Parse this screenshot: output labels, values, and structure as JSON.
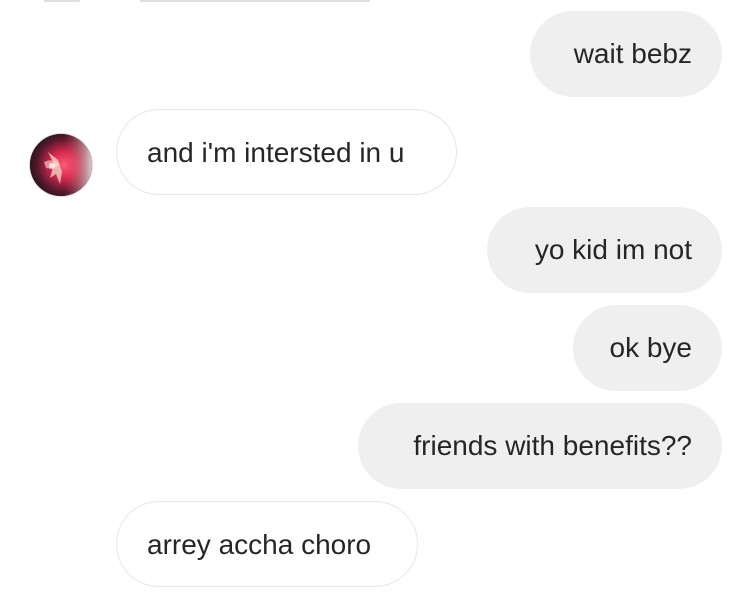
{
  "conversation": {
    "messages": [
      {
        "direction": "sent",
        "text": "wait bebz"
      },
      {
        "direction": "received",
        "text": "and i'm intersted in u",
        "show_avatar": true
      },
      {
        "direction": "sent",
        "text": "yo kid im not"
      },
      {
        "direction": "sent",
        "text": "ok bye"
      },
      {
        "direction": "sent",
        "text": "friends with benefits??"
      },
      {
        "direction": "received",
        "text": "arrey accha choro"
      }
    ]
  },
  "colors": {
    "sent_bubble": "#efefef",
    "received_border": "#e6e6e6",
    "text": "#262626",
    "background": "#ffffff"
  },
  "icons": {
    "avatar": "contact-avatar"
  }
}
